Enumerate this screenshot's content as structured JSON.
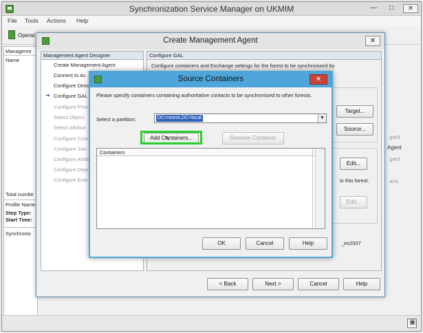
{
  "main_window": {
    "title": "Synchronization Service Manager on UKMIM",
    "menu": [
      "File",
      "Tools",
      "Actions",
      "Help"
    ],
    "toolbar_first_label": "Operat"
  },
  "left_panel": {
    "management_header": "Manageme",
    "name_column": "Name",
    "total_number": "Total numbe",
    "profile_name": "Profile Name",
    "step_type": "Step Type:",
    "start_time": "Start Time:",
    "sync_tab": "Synchroniz"
  },
  "background_right": {
    "agent_1": "gent",
    "agent_2": "Agent",
    "agent_3": "gent",
    "ace": "ace"
  },
  "create_agent_dialog": {
    "title": "Create Management Agent",
    "designer_header": "Management Agent Designer",
    "steps": [
      {
        "label": "Create Management Agent",
        "state": "enabled"
      },
      {
        "label": "Connect to Ac",
        "state": "enabled"
      },
      {
        "label": "Configure Direc",
        "state": "enabled"
      },
      {
        "label": "Configure GAL",
        "state": "current"
      },
      {
        "label": "Configure Prov",
        "state": "disabled"
      },
      {
        "label": "Select Object",
        "state": "disabled"
      },
      {
        "label": "Select Attribut",
        "state": "disabled"
      },
      {
        "label": "Configure Conn",
        "state": "disabled"
      },
      {
        "label": "Configure Join",
        "state": "disabled"
      },
      {
        "label": "Configure Attrib",
        "state": "disabled"
      },
      {
        "label": "Configure Depr",
        "state": "disabled"
      },
      {
        "label": "Configure Exte",
        "state": "disabled"
      }
    ],
    "content_header": "Configure GAL",
    "content_description": "Configure containers and Exchange settings for the forest to be synchronized by",
    "target_button": "Target...",
    "source_button": "Source...",
    "edit_button_1": "Edit...",
    "in_this_forest": "in this forest.",
    "edit_button_2": "Edit...",
    "ex_label": "_ex2007",
    "back_button": "< Back",
    "next_button": "Next >",
    "cancel_button": "Cancel",
    "help_button": "Help"
  },
  "source_containers_dialog": {
    "title": "Source Containers",
    "instructions": "Please specify containers containing authoritative contacts to be synchronized to other forests.",
    "partition_label": "Select a partition:",
    "partition_value": "DC=resntx,DC=local",
    "add_containers_button": "Add Containers...",
    "remove_container_button": "Remove Container",
    "list_header": "Containers",
    "ok_button": "OK",
    "cancel_button": "Cancel",
    "help_button": "Help"
  },
  "colors": {
    "dialog_accent": "#4ea5d9",
    "highlight_box": "#27d12b",
    "selection": "#2e62b8",
    "close_red": "#c9453a"
  }
}
